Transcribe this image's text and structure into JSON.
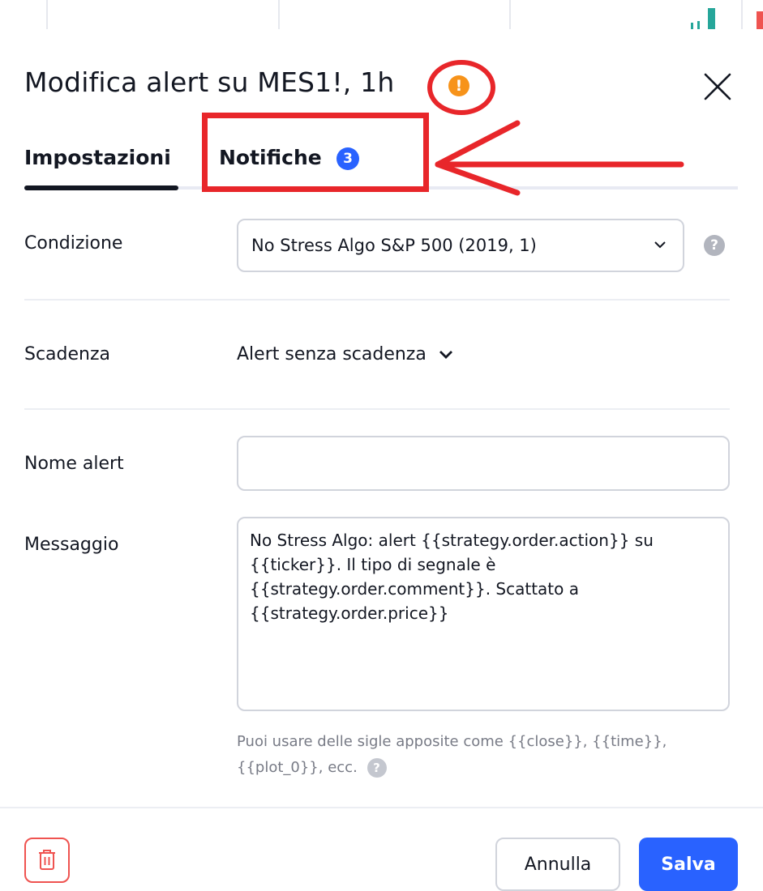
{
  "dialog": {
    "title": "Modifica alert su MES1!, 1h",
    "warning_glyph": "!",
    "close_icon": "close-icon"
  },
  "tabs": [
    {
      "label": "Impostazioni",
      "active": true
    },
    {
      "label": "Notifiche",
      "active": false,
      "badge": "3"
    }
  ],
  "form": {
    "condition": {
      "label": "Condizione",
      "value": "No Stress Algo S&P 500 (2019, 1)",
      "help_glyph": "?"
    },
    "expiry": {
      "label": "Scadenza",
      "value": "Alert senza scadenza"
    },
    "alert_name": {
      "label": "Nome alert",
      "value": ""
    },
    "message": {
      "label": "Messaggio",
      "value": "No Stress Algo: alert {{strategy.order.action}} su {{ticker}}. Il tipo di segnale è {{strategy.order.comment}}. Scattato a {{strategy.order.price}}"
    },
    "hint": {
      "text": "Puoi usare delle sigle apposite come {{close}}, {{time}}, {{plot_0}}, ecc.",
      "help_glyph": "?"
    }
  },
  "footer": {
    "delete_icon": "trash-icon",
    "cancel_label": "Annulla",
    "save_label": "Salva"
  },
  "colors": {
    "accent": "#2962ff",
    "warning": "#f7931a",
    "danger": "#ef5350",
    "annotation": "#e8262a",
    "text": "#131722",
    "muted": "#787b86",
    "border": "#d1d4dc"
  }
}
